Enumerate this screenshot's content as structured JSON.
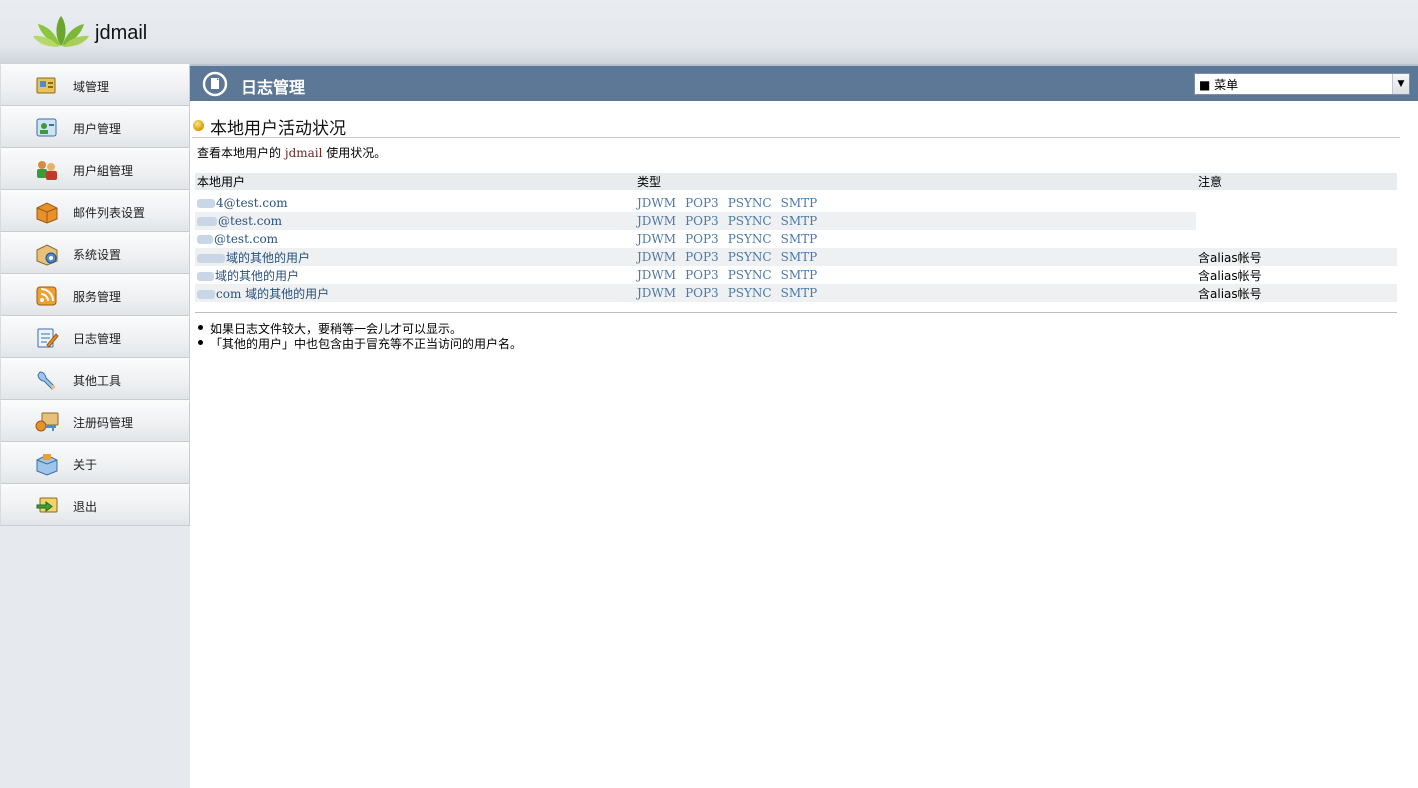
{
  "app": {
    "brand": "jdmail"
  },
  "sidebar": {
    "items": [
      {
        "label": "域管理",
        "icon": "domain-icon"
      },
      {
        "label": "用户管理",
        "icon": "user-icon"
      },
      {
        "label": "用户組管理",
        "icon": "user-group-icon"
      },
      {
        "label": "邮件列表设置",
        "icon": "mailing-list-icon"
      },
      {
        "label": "系统设置",
        "icon": "system-settings-icon"
      },
      {
        "label": "服务管理",
        "icon": "service-icon"
      },
      {
        "label": "日志管理",
        "icon": "log-icon"
      },
      {
        "label": "其他工具",
        "icon": "tools-icon"
      },
      {
        "label": "注册码管理",
        "icon": "license-key-icon"
      },
      {
        "label": "关于",
        "icon": "about-icon"
      },
      {
        "label": "退出",
        "icon": "logout-icon"
      }
    ]
  },
  "header": {
    "title": "日志管理",
    "menu_value": "■ 菜单"
  },
  "section": {
    "title": "本地用户活动状况",
    "desc_prefix": "查看本地用户的",
    "desc_brand": "jdmail",
    "desc_suffix": "使用状况。"
  },
  "table": {
    "columns": [
      "本地用户",
      "类型",
      "注意"
    ],
    "types": [
      "JDWM",
      "POP3",
      "PSYNC",
      "SMTP"
    ],
    "rows": [
      {
        "user": "4@test.com",
        "note": ""
      },
      {
        "user": "@test.com",
        "note": ""
      },
      {
        "user": "@test.com",
        "note": ""
      },
      {
        "user": "域的其他的用户",
        "note": "含alias帐号"
      },
      {
        "user": "域的其他的用户",
        "note": "含alias帐号"
      },
      {
        "user": "com 域的其他的用户",
        "note": "含alias帐号"
      }
    ]
  },
  "tips": [
    "如果日志文件较大，要稍等一会儿才可以显示。",
    "「其他的用户」中也包含由于冒充等不正当访问的用户名。"
  ],
  "colors": {
    "titlebar": "#5d7797",
    "link": "#27527e",
    "types": "#4c79a5"
  }
}
